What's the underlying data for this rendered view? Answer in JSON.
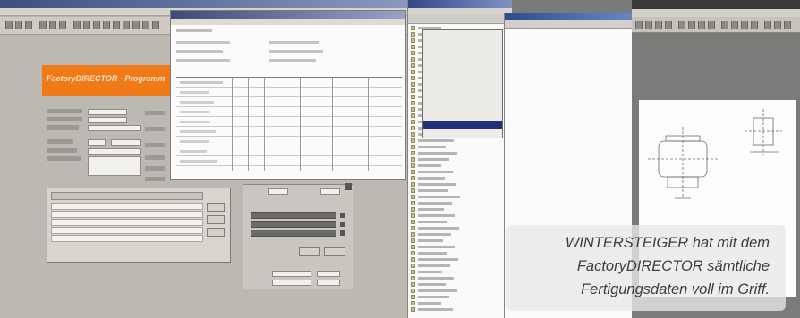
{
  "caption": {
    "line1": "WINTERSTEIGER hat mit dem",
    "line2": "FactoryDIRECTOR sämtliche",
    "line3": "Fertigungsdaten voll im Griff."
  },
  "app": {
    "banner_title": "FactoryDIRECTOR - Programm"
  },
  "icons": {
    "toolbar": "toolbar-icon",
    "tree_node": "folder-icon",
    "cad_part": "part-drawing-icon"
  },
  "colors": {
    "banner": "#f07a18",
    "titlebar": "#3e4f80",
    "selection": "#1f2f7a"
  }
}
